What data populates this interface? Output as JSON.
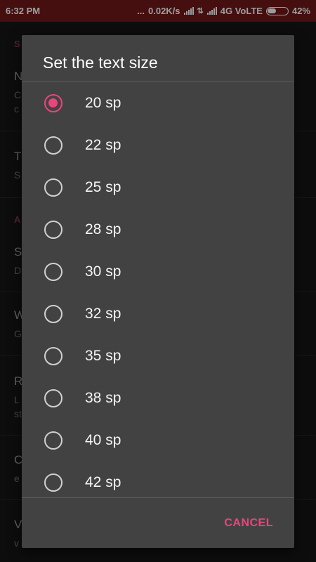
{
  "status_bar": {
    "time": "6:32 PM",
    "dots": "...",
    "speed": "0.02K/s",
    "network": "4G VoLTE",
    "battery": "42%",
    "battery_level": 0.42
  },
  "background": {
    "items": [
      {
        "text": "S",
        "style": "accent"
      },
      {
        "text": "N",
        "style": "title"
      },
      {
        "text": "C",
        "style": "sub"
      },
      {
        "text": "c",
        "style": "sub"
      },
      {
        "text": "T",
        "style": "title"
      },
      {
        "text": "S",
        "style": "sub"
      },
      {
        "text": "A",
        "style": "accent"
      },
      {
        "text": "S",
        "style": "title"
      },
      {
        "text": "D",
        "style": "sub"
      },
      {
        "text": "W",
        "style": "title"
      },
      {
        "text": "G",
        "style": "sub"
      },
      {
        "text": "R",
        "style": "title"
      },
      {
        "text": "L",
        "style": "sub"
      },
      {
        "text": "st",
        "style": "sub"
      },
      {
        "text": "C",
        "style": "title"
      },
      {
        "text": "e",
        "style": "sub"
      },
      {
        "text": "V",
        "style": "title"
      },
      {
        "text": "v",
        "style": "sub"
      }
    ]
  },
  "dialog": {
    "title": "Set the text size",
    "options": [
      {
        "label": "20 sp",
        "selected": true
      },
      {
        "label": "22 sp",
        "selected": false
      },
      {
        "label": "25 sp",
        "selected": false
      },
      {
        "label": "28 sp",
        "selected": false
      },
      {
        "label": "30 sp",
        "selected": false
      },
      {
        "label": "32 sp",
        "selected": false
      },
      {
        "label": "35 sp",
        "selected": false
      },
      {
        "label": "38 sp",
        "selected": false
      },
      {
        "label": "40 sp",
        "selected": false
      },
      {
        "label": "42 sp",
        "selected": false
      }
    ],
    "cancel_label": "CANCEL"
  },
  "colors": {
    "accent": "#e8457c",
    "status_bar": "#6a1618",
    "dialog_bg": "#424242"
  }
}
